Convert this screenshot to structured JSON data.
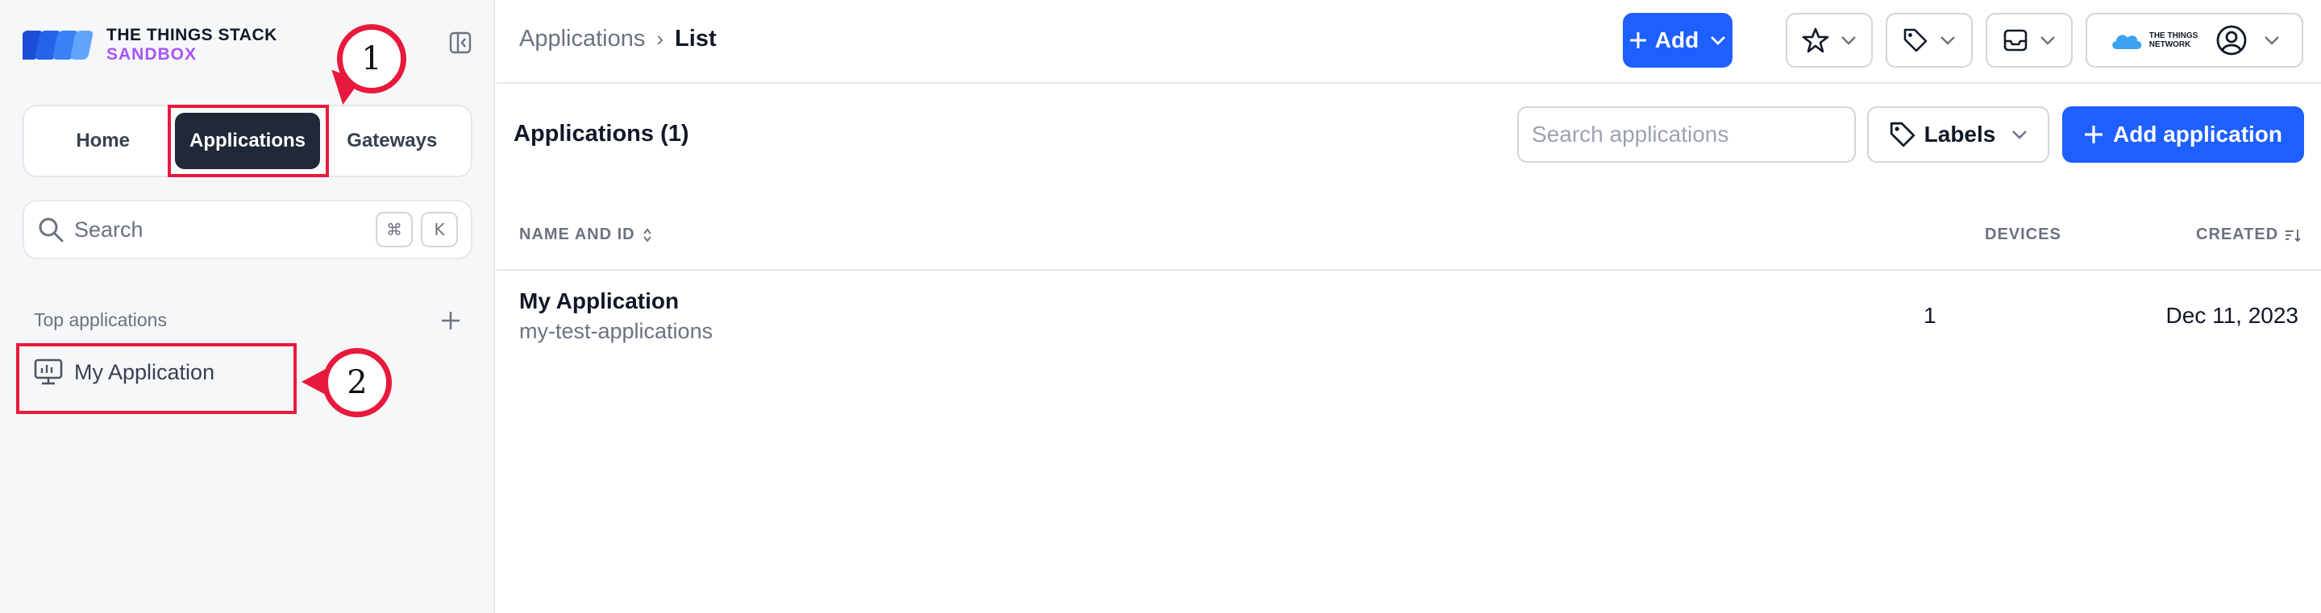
{
  "colors": {
    "primary": "#1d5fff",
    "sidebar_bg": "#f6f7f9",
    "active_tab_bg": "#1f2937",
    "brand_purple": "#a855f7",
    "annotation_red": "#e8193c",
    "muted_text": "#6b7280"
  },
  "brand": {
    "line1": "THE THINGS STACK",
    "line2": "SANDBOX",
    "icon": "tts-logo-icon"
  },
  "sidebar": {
    "collapse_icon": "sidebar-collapse-icon",
    "tabs": [
      {
        "label": "Home",
        "active": false
      },
      {
        "label": "Applications",
        "active": true
      },
      {
        "label": "Gateways",
        "active": false
      }
    ],
    "search": {
      "placeholder": "Search",
      "shortcut_keys": [
        "⌘",
        "K"
      ]
    },
    "top_applications": {
      "label": "Top applications",
      "add_icon": "plus-icon",
      "items": [
        {
          "label": "My Application",
          "icon": "monitor-icon"
        }
      ]
    }
  },
  "annotations": [
    {
      "number": "1",
      "target": "Applications tab"
    },
    {
      "number": "2",
      "target": "My Application"
    }
  ],
  "topbar": {
    "breadcrumb": {
      "parent": "Applications",
      "separator": "›",
      "current": "List"
    },
    "add_button": {
      "label": "Add",
      "icon": "plus-icon"
    },
    "bookmarks_icon": "star-icon",
    "labels_icon": "tag-icon",
    "notifications_icon": "inbox-icon",
    "network_logo": {
      "line1": "THE THINGS",
      "line2": "NETWORK"
    },
    "account_icon": "user-circle-icon"
  },
  "main": {
    "title": "Applications (1)",
    "search": {
      "placeholder": "Search applications",
      "value": ""
    },
    "labels_button": "Labels",
    "add_application_button": "Add application",
    "table": {
      "columns": [
        {
          "label": "NAME AND ID",
          "sort_icon": "sort-updown-icon"
        },
        {
          "label": "DEVICES"
        },
        {
          "label": "CREATED",
          "sort_icon": "sort-desc-icon"
        }
      ],
      "rows": [
        {
          "name": "My Application",
          "id": "my-test-applications",
          "devices": "1",
          "created": "Dec 11, 2023"
        }
      ]
    }
  }
}
